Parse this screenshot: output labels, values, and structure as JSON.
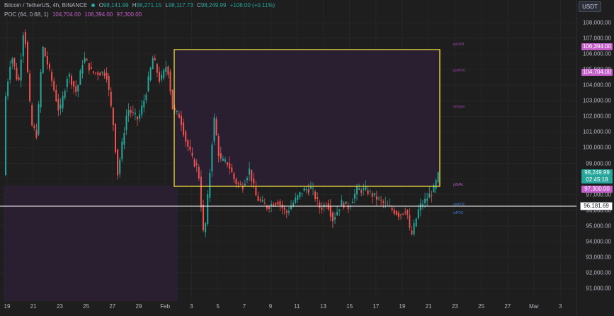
{
  "legend": {
    "symbol": "Bitcoin / TetherUS, 4h, BINANCE",
    "o_label": "O",
    "o": "98,141.99",
    "h_label": "H",
    "h": "98,271.15",
    "l_label": "L",
    "l": "98,117.73",
    "c_label": "C",
    "c": "98,249.99",
    "change": "+108.00 (+0.11%)",
    "indicator": "POC (64, 0.68, 1)",
    "ind_v1": "104,704.00",
    "ind_v2": "106,394.00",
    "ind_v3": "97,300.00"
  },
  "currency": "USDT",
  "price_axis": {
    "ticks": [
      "108,000.00",
      "107,000.00",
      "106,000.00",
      "105,000.00",
      "104,000.00",
      "103,000.00",
      "102,000.00",
      "101,000.00",
      "100,000.00",
      "99,000.00",
      "98,000.00",
      "97,000.00",
      "96,000.00",
      "95,000.00",
      "94,000.00",
      "93,000.00",
      "92,000.00",
      "91,000.00"
    ],
    "tick_values": [
      108000,
      107000,
      106000,
      105000,
      104000,
      103000,
      102000,
      101000,
      100000,
      99000,
      98000,
      97000,
      96000,
      95000,
      94000,
      93000,
      92000,
      91000
    ]
  },
  "time_axis": {
    "ticks": [
      "19",
      "21",
      "23",
      "25",
      "27",
      "29",
      "Feb",
      "3",
      "5",
      "7",
      "9",
      "11",
      "13",
      "15",
      "17",
      "19",
      "21",
      "23",
      "25",
      "27",
      "Mar",
      "3"
    ]
  },
  "price_labels": {
    "vah": "106,394.00",
    "poc": "104,704.00",
    "last": "98,249.99",
    "countdown": "02:45:18",
    "val": "97,300.00",
    "crosshair": "96,181.69"
  },
  "level_labels": {
    "pdVAH": "pdVAH",
    "pmPOC": "pmPOC",
    "mOpen": "mOpen",
    "pdVAL": "pdVAL",
    "pwPOC": "pwPOC",
    "wPOC": "wPOC"
  },
  "colors": {
    "bg": "#1e1e1e",
    "up": "#26a69a",
    "down": "#ef5350",
    "box": "#f0e03c",
    "box_fill": "#2a1f33",
    "magenta": "#c45ec8",
    "crosshair": "#ffffff"
  }
}
